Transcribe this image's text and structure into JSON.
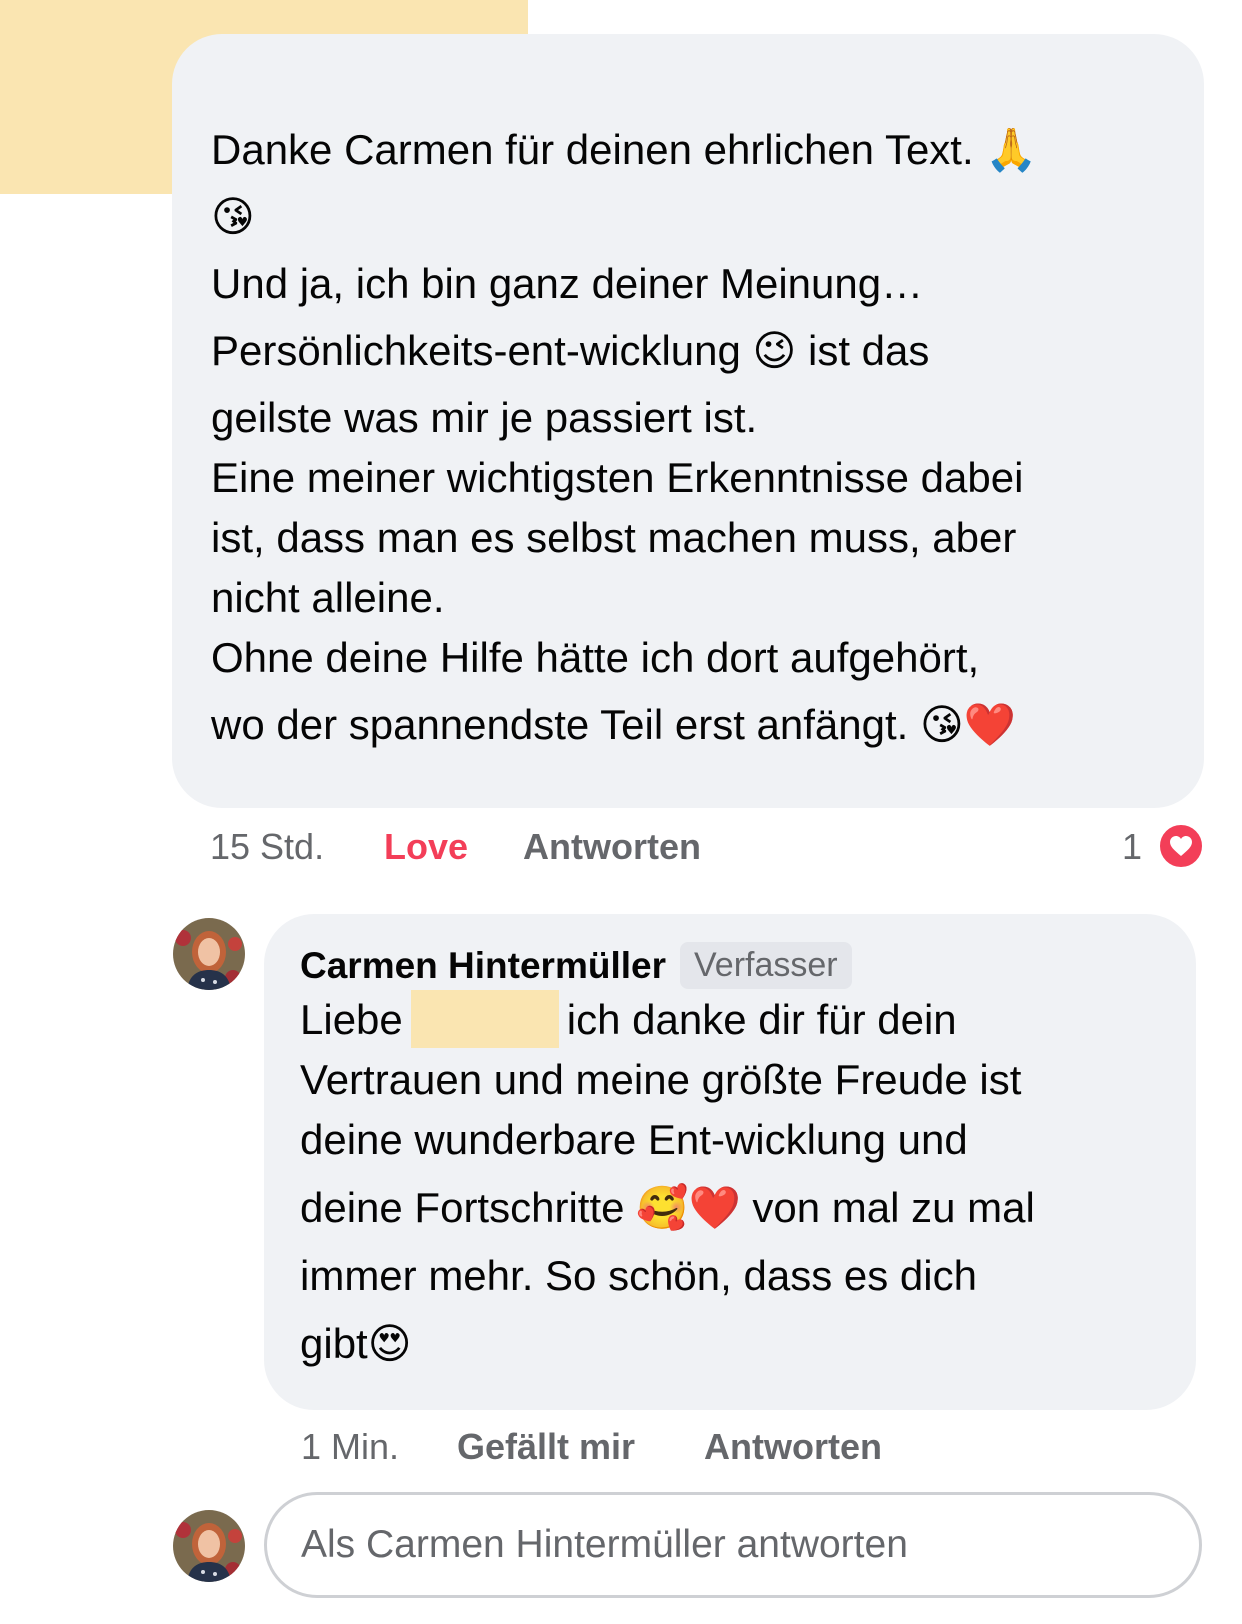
{
  "comment": {
    "lines": [
      "Danke Carmen für deinen ehrlichen Text. 🙏",
      "😘",
      "Und ja, ich bin ganz deiner Meinung…",
      "Persönlichkeits-ent-wicklung 😉 ist das",
      "geilste was mir je passiert ist.",
      "Eine meiner wichtigsten Erkenntnisse dabei",
      "ist, dass man es selbst machen muss, aber",
      "nicht alleine.",
      "Ohne deine Hilfe hätte ich dort aufgehört,",
      "wo der spannendste Teil erst anfängt. 😘❤️"
    ],
    "time": "15 Std.",
    "reaction_label": "Love",
    "reply_label": "Antworten",
    "reaction_count": "1",
    "reaction_icon": "heart-icon"
  },
  "reply": {
    "author": "Carmen Hintermüller",
    "author_badge": "Verfasser",
    "line1_before": "Liebe",
    "line1_after": "ich danke dir für dein",
    "lines": [
      "Vertrauen und meine größte Freude ist",
      "deine wunderbare Ent-wicklung und",
      "deine Fortschritte 🥰❤️ von mal zu mal",
      "immer mehr. So schön, dass es dich",
      "gibt😍"
    ],
    "time": "1 Min.",
    "like_label": "Gefällt mir",
    "reply_label": "Antworten"
  },
  "reply_box": {
    "placeholder": "Als Carmen Hintermüller antworten"
  },
  "colors": {
    "bubble": "#f0f2f5",
    "love": "#f33e58",
    "meta": "#65676b",
    "redaction": "#fae5b1"
  }
}
